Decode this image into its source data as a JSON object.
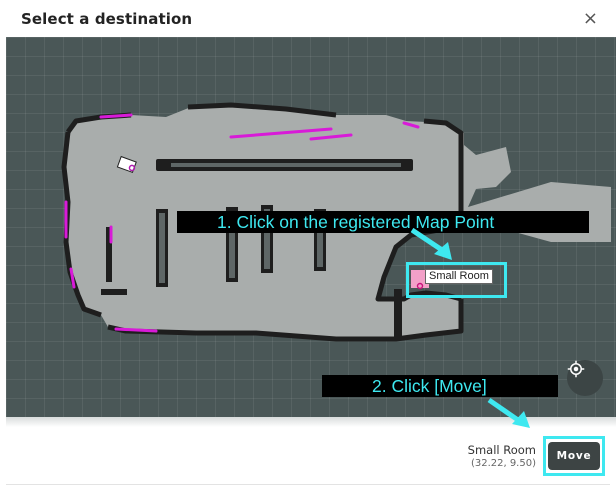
{
  "dialog": {
    "title": "Select a destination",
    "close_symbol": "×"
  },
  "map": {
    "map_point": {
      "name": "Small Room"
    },
    "instructions": {
      "step1": "1.    Click on the registered Map Point",
      "step2": "2. Click [Move]"
    },
    "colors": {
      "background": "#4a5757",
      "floor": "#a9adac",
      "walls": "#1e1e1e",
      "highlight_edges": "#d81ad8",
      "annotation": "#3ee8f0"
    }
  },
  "footer": {
    "destination_name": "Small Room",
    "destination_coords": "(32.22, 9.50)",
    "move_label": "Move"
  },
  "icons": {
    "close": "close-icon",
    "locate": "locate-icon",
    "robot": "robot-icon"
  }
}
